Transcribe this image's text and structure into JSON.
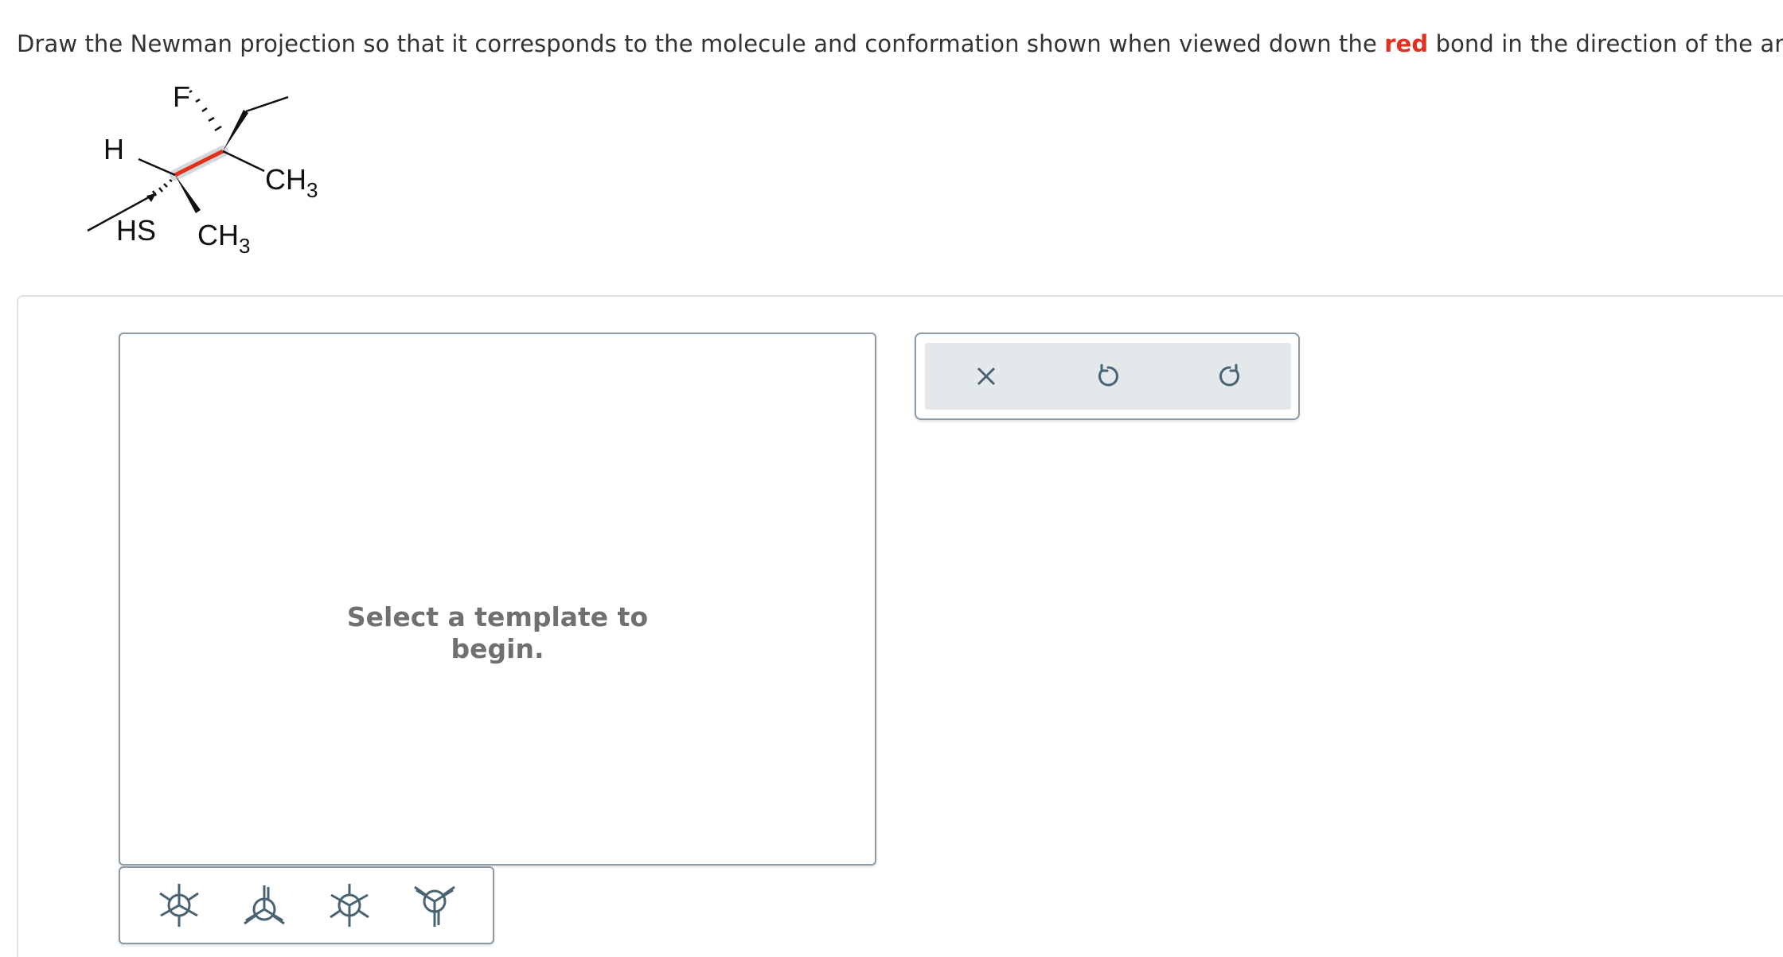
{
  "question": {
    "prefix": "Draw the Newman projection so that it corresponds to the molecule and conformation shown when viewed down the",
    "highlight": "red",
    "suffix": "bond in the direction of the arrow."
  },
  "molecule": {
    "labels": {
      "f": "F",
      "h": "H",
      "hs": "HS",
      "ch3_bottom": "CH",
      "ch3_bottom_sub": "3",
      "ch3_right": "CH",
      "ch3_right_sub": "3"
    },
    "colors": {
      "highlight_bond": "#e0301e",
      "bond": "#111111",
      "highlight_shadow": "#d5d8da"
    }
  },
  "canvas": {
    "message_line1": "Select a template to",
    "message_line2": "begin."
  },
  "templates": [
    {
      "icon": "newman-staggered-icon"
    },
    {
      "icon": "newman-eclipsed-icon"
    },
    {
      "icon": "newman-staggered-alt-icon"
    },
    {
      "icon": "newman-eclipsed-alt-icon"
    }
  ],
  "toolbar": [
    {
      "icon": "close-icon"
    },
    {
      "icon": "undo-icon"
    },
    {
      "icon": "redo-icon"
    }
  ],
  "colors": {
    "icon": "#4a6373",
    "border": "#8a9aa6",
    "toolbar_bg": "#e3e8eb",
    "accent_red": "#e0301e"
  }
}
